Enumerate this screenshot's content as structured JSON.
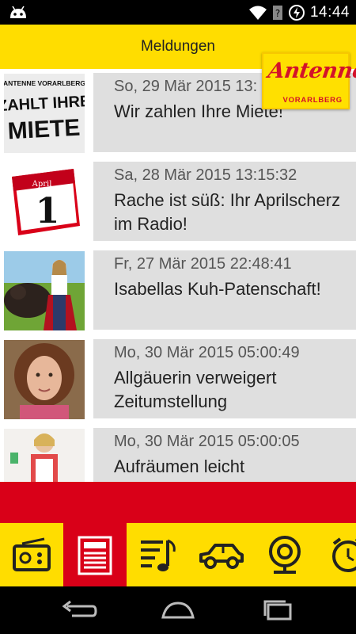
{
  "status_bar": {
    "time": "14:44",
    "icons": [
      "android-debug-icon",
      "wifi-icon",
      "sim-unknown-icon",
      "battery-charging-icon"
    ]
  },
  "header": {
    "title": "Meldungen",
    "logo_text": "Antenne",
    "logo_subtext": "VORARLBERG"
  },
  "news": [
    {
      "date": "So, 29 Mär 2015 13:",
      "headline": "Wir zahlen Ihre Miete!",
      "thumb": "zahlt-ihre-miete-thumbnail",
      "thumb_text_top": "ANTENNE VORARLBERG",
      "thumb_text_mid": "ZAHLT IHRE",
      "thumb_text_bottom": "MIETE"
    },
    {
      "date": "Sa, 28 Mär 2015 13:15:32",
      "headline": "Rache ist süß: Ihr Aprilscherz im Radio!",
      "thumb": "april-calendar-thumbnail",
      "thumb_text_top": "April",
      "thumb_text_mid": "1"
    },
    {
      "date": "Fr, 27 Mär 2015 22:48:41",
      "headline": "Isabellas Kuh-Patenschaft!",
      "thumb": "woman-with-cow-thumbnail"
    },
    {
      "date": "Mo, 30 Mär 2015 05:00:49",
      "headline": "Allgäuerin verweigert Zeitumstellung",
      "thumb": "woman-portrait-thumbnail"
    },
    {
      "date": "Mo, 30 Mär 2015 05:00:05",
      "headline": "Aufräumen leicht",
      "thumb": "woman-cleaning-thumbnail"
    }
  ],
  "bottom_nav": [
    {
      "name": "radio",
      "icon": "radio-icon",
      "active": false
    },
    {
      "name": "news",
      "icon": "newspaper-icon",
      "active": true
    },
    {
      "name": "playlist",
      "icon": "playlist-music-icon",
      "active": false
    },
    {
      "name": "traffic",
      "icon": "car-icon",
      "active": false
    },
    {
      "name": "webcam",
      "icon": "webcam-icon",
      "active": false
    },
    {
      "name": "alarm",
      "icon": "alarm-clock-icon",
      "active": false
    }
  ],
  "colors": {
    "yellow": "#ffdd00",
    "red": "#d90018",
    "card_gray": "#dfdfdf"
  }
}
